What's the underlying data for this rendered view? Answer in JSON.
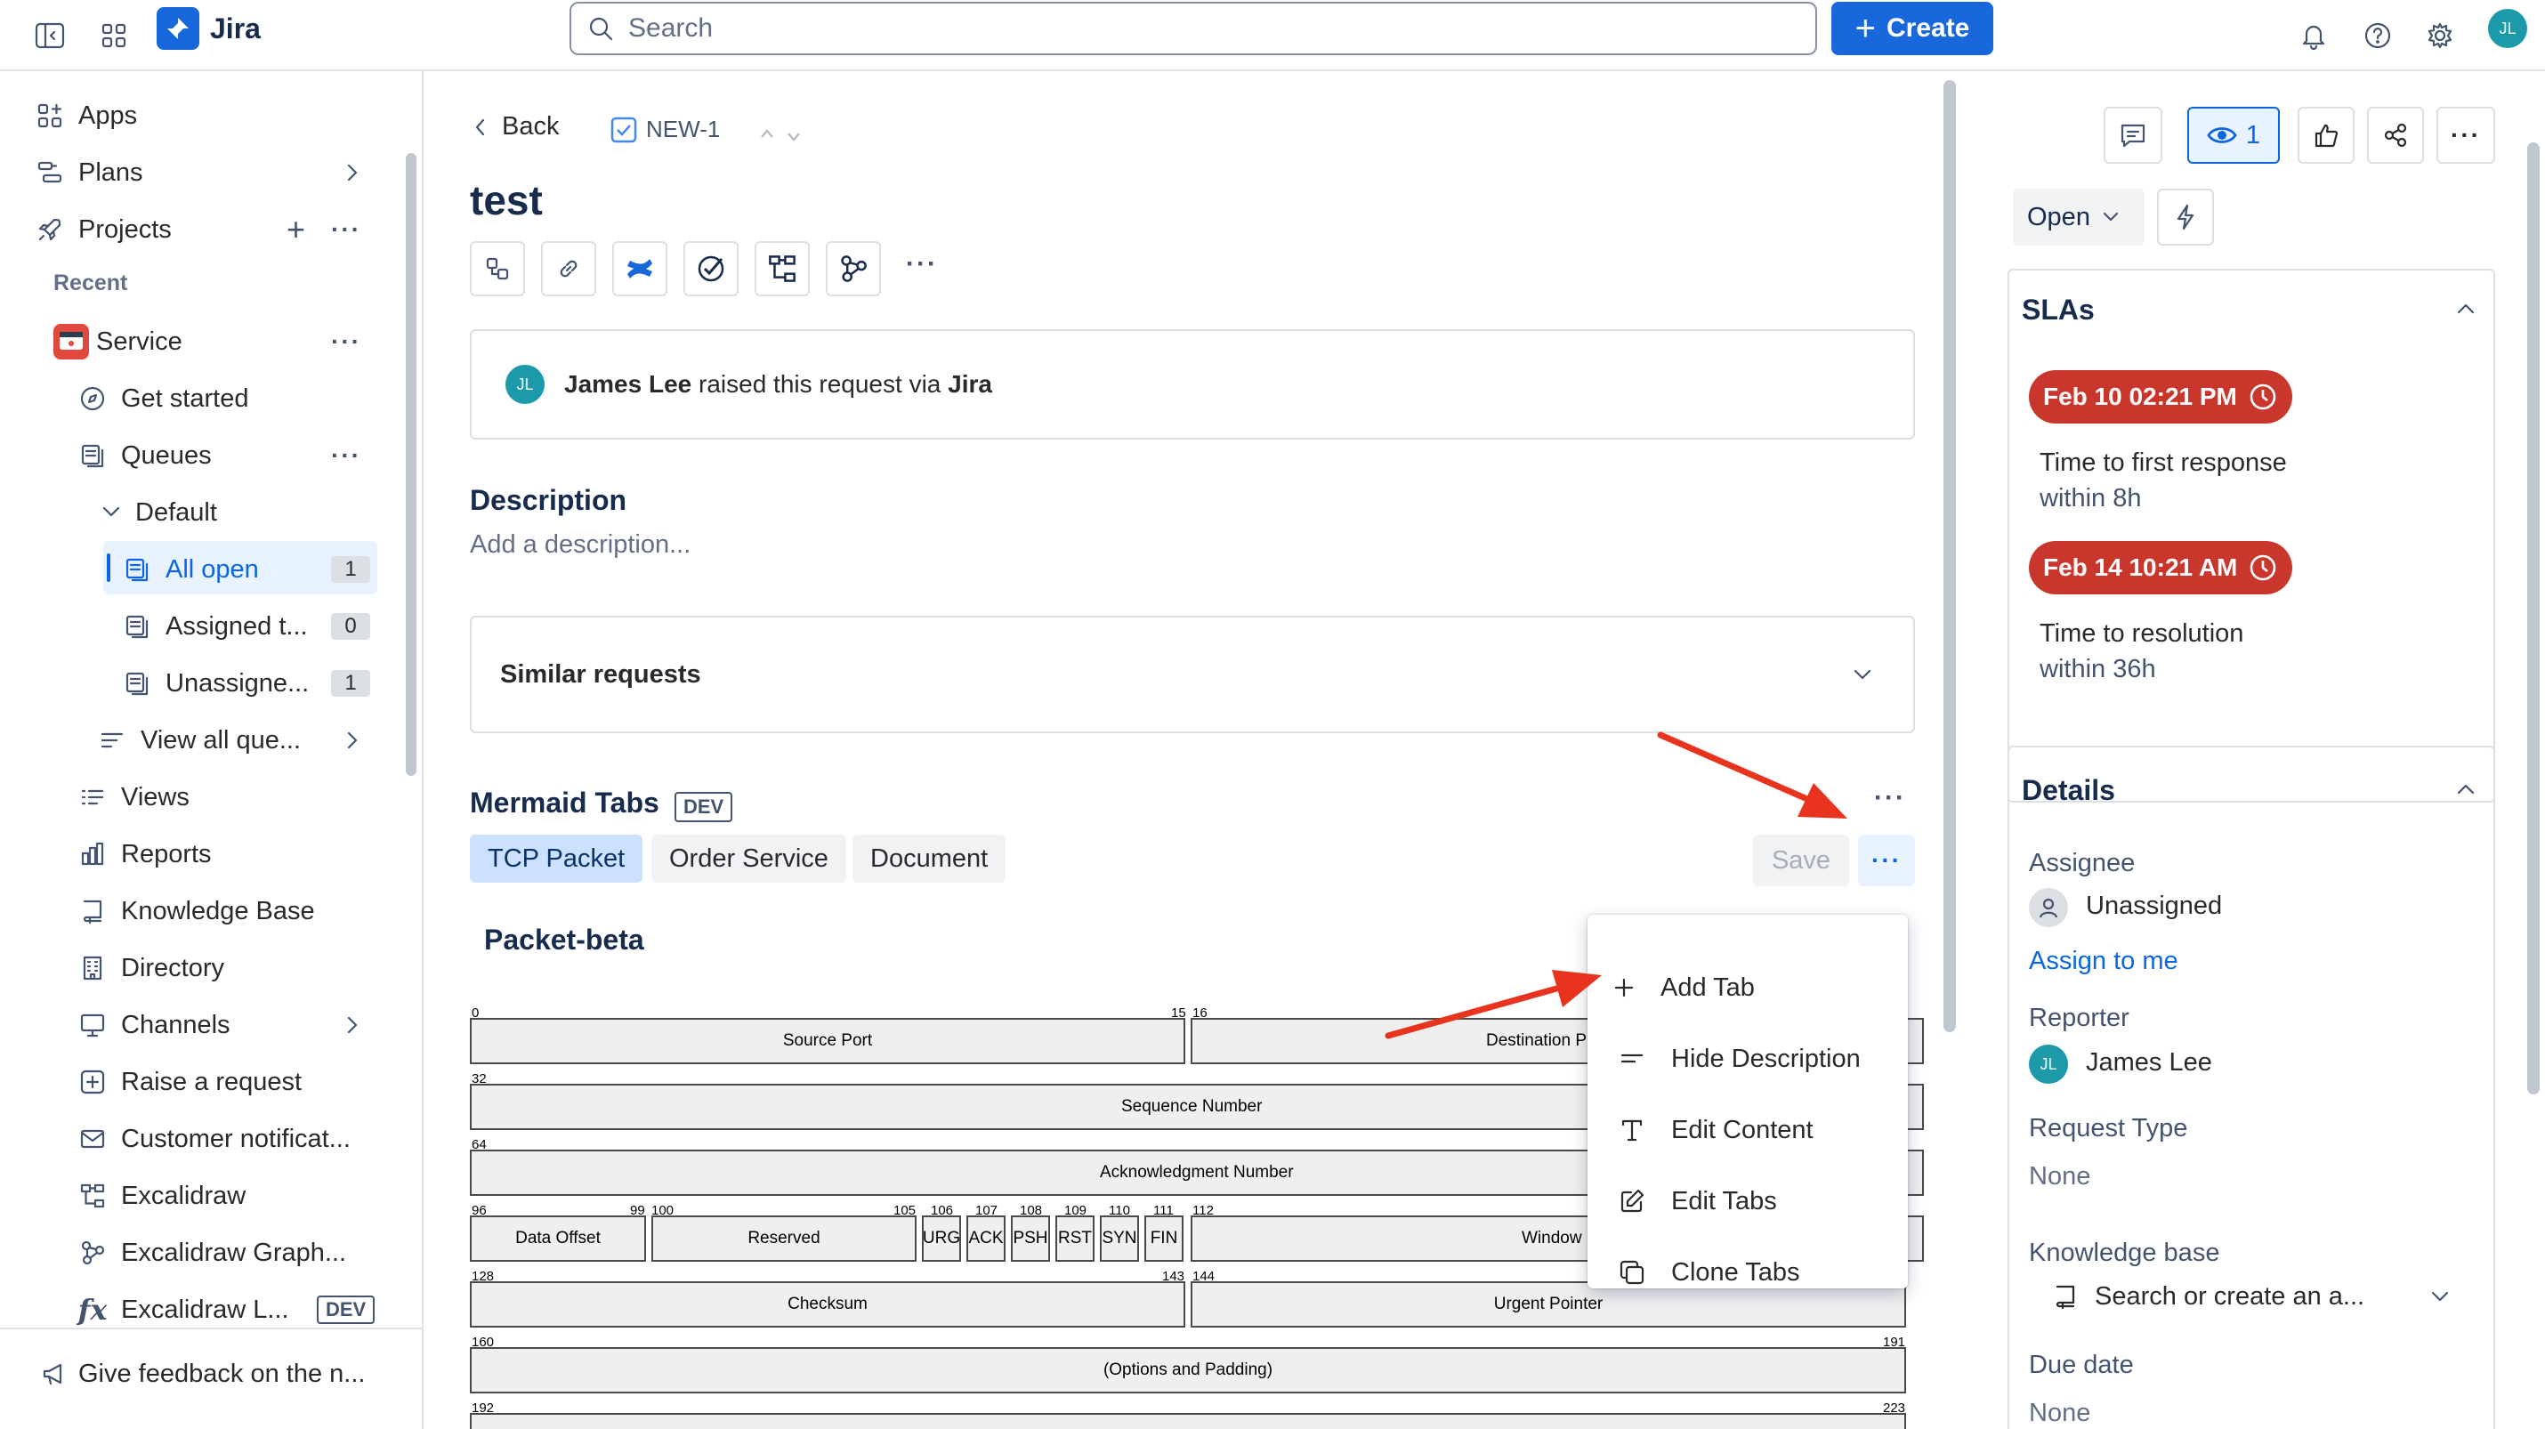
{
  "topbar": {
    "product": "Jira",
    "search_placeholder": "Search",
    "create_label": "Create",
    "user_initials": "JL"
  },
  "sidebar": {
    "apps": "Apps",
    "plans": "Plans",
    "projects": "Projects",
    "recent": "Recent",
    "service": "Service",
    "get_started": "Get started",
    "queues": "Queues",
    "default": "Default",
    "all_open": "All open",
    "all_open_count": "1",
    "assigned": "Assigned t...",
    "assigned_count": "0",
    "unassigned": "Unassigne...",
    "unassigned_count": "1",
    "view_all_queues": "View all que...",
    "views": "Views",
    "reports": "Reports",
    "knowledge_base": "Knowledge Base",
    "directory": "Directory",
    "channels": "Channels",
    "raise_request": "Raise a request",
    "customer_notifications": "Customer notificat...",
    "excalidraw": "Excalidraw",
    "excalidraw_graph": "Excalidraw Graph...",
    "excalidraw_l": "Excalidraw L...",
    "dev_badge": "DEV",
    "feedback": "Give feedback on the n..."
  },
  "issue": {
    "back": "Back",
    "key": "NEW-1",
    "title": "test",
    "raised_by": "James Lee",
    "raised_text": " raised this request via ",
    "raised_via": "Jira",
    "reporter_initials": "JL",
    "description_heading": "Description",
    "description_placeholder": "Add a description...",
    "similar_requests": "Similar requests"
  },
  "mermaid": {
    "heading": "Mermaid Tabs",
    "badge": "DEV",
    "tabs": [
      "TCP Packet",
      "Order Service",
      "Document"
    ],
    "save": "Save",
    "diagram_title": "Packet-beta",
    "fields": {
      "source_port": "Source Port",
      "destination_port": "Destination P",
      "sequence_number": "Sequence Number",
      "ack_number": "Acknowledgment Number",
      "data_offset": "Data Offset",
      "reserved": "Reserved",
      "urg": "URG",
      "ack": "ACK",
      "psh": "PSH",
      "rst": "RST",
      "syn": "SYN",
      "fin": "FIN",
      "window": "Window",
      "checksum": "Checksum",
      "urgent_pointer": "Urgent Pointer",
      "options": "(Options and Padding)"
    },
    "bits": {
      "b0": "0",
      "b15": "15",
      "b16": "16",
      "b32": "32",
      "b64": "64",
      "b96": "96",
      "b99": "99",
      "b100": "100",
      "b105": "105",
      "b106": "106",
      "b107": "107",
      "b108": "108",
      "b109": "109",
      "b110": "110",
      "b111": "111",
      "b112": "112",
      "b128": "128",
      "b143": "143",
      "b144": "144",
      "b160": "160",
      "b191": "191",
      "b192": "192",
      "b223": "223"
    },
    "menu": [
      "Add Tab",
      "Hide Description",
      "Edit Content",
      "Edit Tabs",
      "Clone Tabs"
    ]
  },
  "right": {
    "watch_count": "1",
    "status": "Open",
    "slas_heading": "SLAs",
    "sla1_time": "Feb 10 02:21 PM",
    "sla1_label": "Time to first response",
    "sla1_goal": "within 8h",
    "sla2_time": "Feb 14 10:21 AM",
    "sla2_label": "Time to resolution",
    "sla2_goal": "within 36h",
    "details_heading": "Details",
    "assignee_label": "Assignee",
    "assignee_value": "Unassigned",
    "assign_to_me": "Assign to me",
    "reporter_label": "Reporter",
    "reporter_value": "James Lee",
    "reporter_initials": "JL",
    "request_type_label": "Request Type",
    "request_type_value": "None",
    "kb_label": "Knowledge base",
    "kb_placeholder": "Search or create an a...",
    "due_label": "Due date",
    "due_value": "None"
  },
  "colors": {
    "brand": "#1868db",
    "sla_breach": "#c9372c",
    "annotation_arrow": "#e8331e"
  }
}
